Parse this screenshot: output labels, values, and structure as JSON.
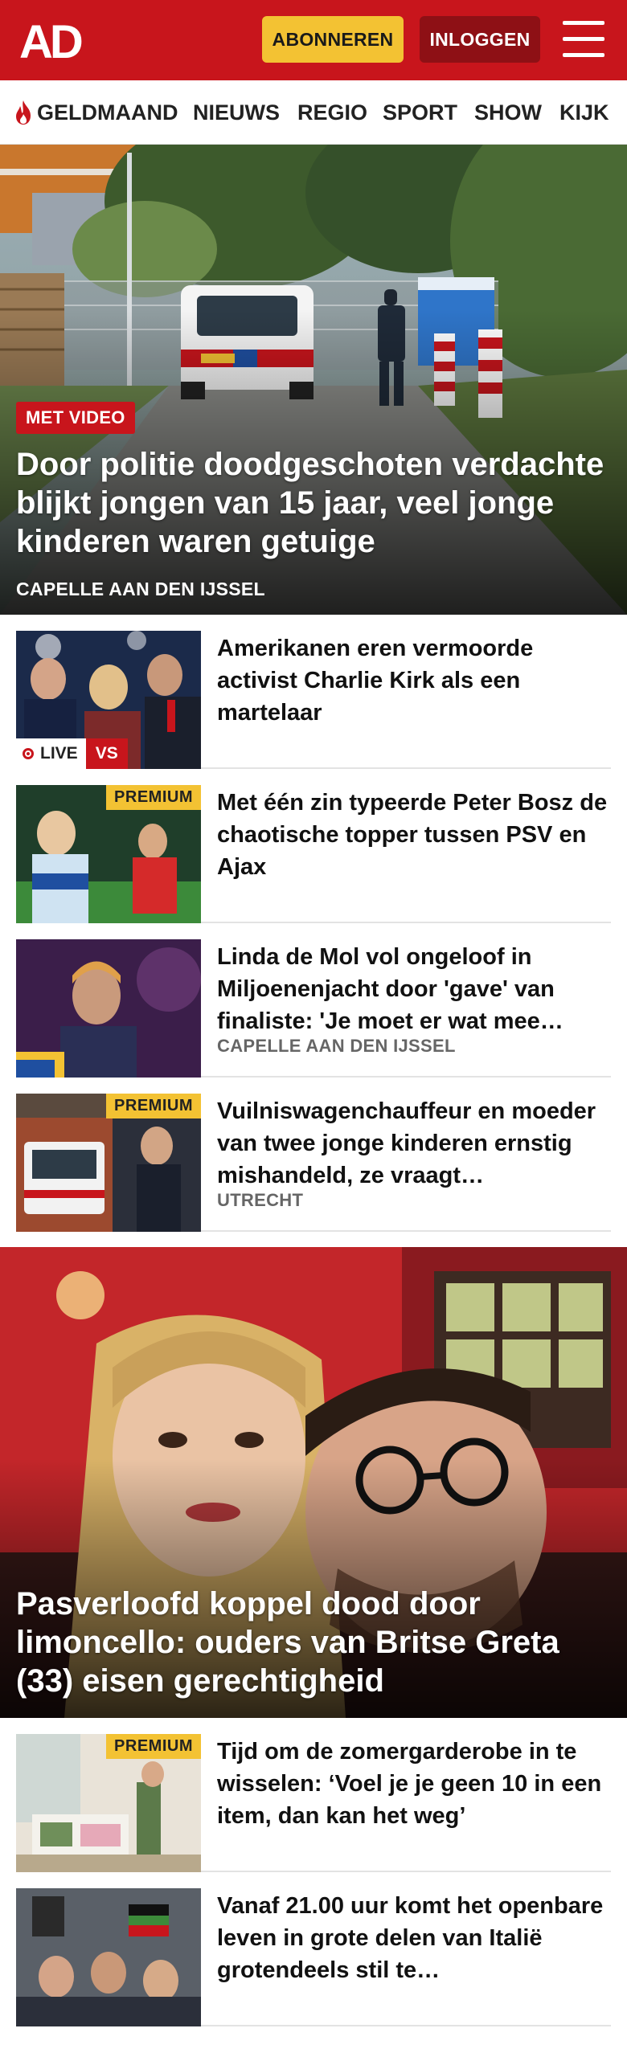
{
  "header": {
    "logo_text": "AD",
    "subscribe_label": "ABONNEREN",
    "login_label": "INLOGGEN",
    "brand_color": "#c8151c",
    "subscribe_color": "#f3c233"
  },
  "nav": {
    "items": [
      {
        "label": "GELDMAAND",
        "icon": "flame-icon"
      },
      {
        "label": "NIEUWS"
      },
      {
        "label": "REGIO"
      },
      {
        "label": "SPORT"
      },
      {
        "label": "SHOW"
      },
      {
        "label": "KIJK"
      }
    ]
  },
  "hero": {
    "badge": "MET VIDEO",
    "title": "Door politie doodgeschoten verdachte blijkt jongen van 15 jaar, veel jonge kinderen waren getuige",
    "location": "CAPELLE AAN DEN IJSSEL"
  },
  "articles": [
    {
      "title": "Amerikanen eren vermoorde activist Charlie Kirk als een martelaar",
      "live_label": "LIVE",
      "vs_label": "VS"
    },
    {
      "title": "Met één zin typeerde Peter Bosz de chaotische topper tussen PSV en Ajax",
      "premium": "PREMIUM"
    },
    {
      "title": "Linda de Mol vol ongeloof in Miljoenenjacht door 'gave' van finaliste: 'Je moet er wat mee…",
      "location": "CAPELLE AAN DEN IJSSEL"
    },
    {
      "title": "Vuilniswagenchauffeur en moeder van twee jonge kinderen ernstig mishandeld, ze vraagt…",
      "premium": "PREMIUM",
      "location": "UTRECHT"
    }
  ],
  "hero2": {
    "title": "Pasverloofd koppel dood door limoncello: ouders van Britse Greta (33) eisen gerechtigheid"
  },
  "articles2": [
    {
      "title": "Tijd om de zomergarderobe in te wisselen: ‘Voel je je geen 10 in een item, dan kan het weg’",
      "premium": "PREMIUM"
    },
    {
      "title": "Vanaf 21.00 uur komt het openbare leven in grote delen van Italië grotendeels stil te…"
    }
  ]
}
